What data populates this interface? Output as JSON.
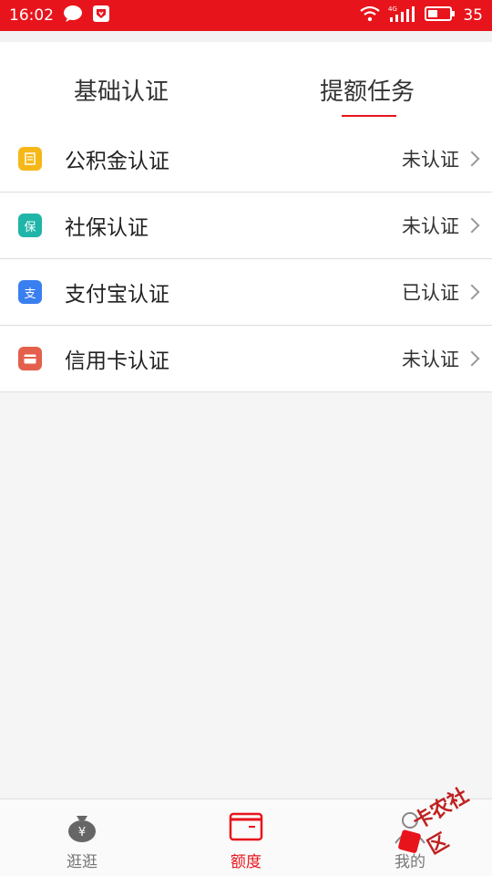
{
  "status_bar": {
    "time": "16:02",
    "network": "4G",
    "battery": "35"
  },
  "tabs": [
    {
      "label": "基础认证",
      "active": false
    },
    {
      "label": "提额任务",
      "active": true
    }
  ],
  "list": [
    {
      "label": "公积金认证",
      "status": "未认证",
      "icon": "housing-fund-icon",
      "color": "#f6b818"
    },
    {
      "label": "社保认证",
      "status": "未认证",
      "icon": "social-security-icon",
      "color": "#1fb5a8",
      "glyph": "保"
    },
    {
      "label": "支付宝认证",
      "status": "已认证",
      "icon": "alipay-icon",
      "color": "#3a7ff0",
      "glyph": "支"
    },
    {
      "label": "信用卡认证",
      "status": "未认证",
      "icon": "credit-card-icon",
      "color": "#e4604c"
    }
  ],
  "bottom_nav": [
    {
      "label": "逛逛",
      "icon": "money-bag-icon",
      "active": false
    },
    {
      "label": "额度",
      "icon": "card-icon",
      "active": true
    },
    {
      "label": "我的",
      "icon": "person-icon",
      "active": false
    }
  ],
  "watermark": {
    "text": "卡农社区"
  },
  "colors": {
    "accent": "#e8141c",
    "background": "#f5f5f5"
  }
}
